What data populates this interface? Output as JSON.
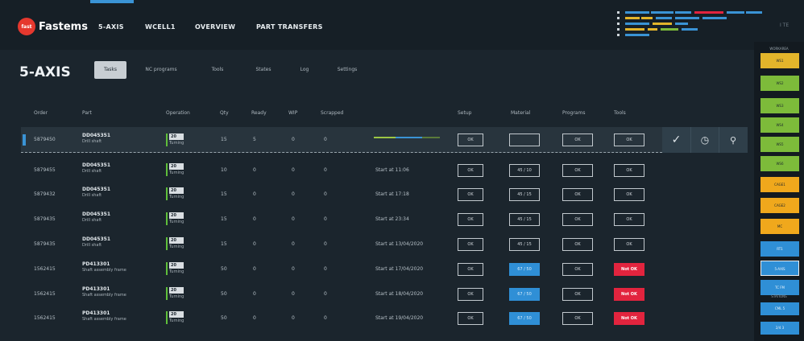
{
  "app": {
    "brand": "Fastems",
    "logo_mark": "fast",
    "top_right": "I TE"
  },
  "nav": [
    {
      "label": "5-AXIS",
      "active": true
    },
    {
      "label": "WCELL1",
      "active": false
    },
    {
      "label": "OVERVIEW",
      "active": false
    },
    {
      "label": "PART TRANSFERS",
      "active": false
    }
  ],
  "page": {
    "title": "5-AXIS"
  },
  "tabs": [
    {
      "label": "Tasks",
      "active": true
    },
    {
      "label": "NC programs",
      "active": false
    },
    {
      "label": "Tools",
      "active": false
    },
    {
      "label": "States",
      "active": false
    },
    {
      "label": "Log",
      "active": false
    },
    {
      "label": "Settings",
      "active": false
    }
  ],
  "columns": [
    "Order",
    "Part",
    "Operation",
    "Qty",
    "Ready",
    "WIP",
    "Scrapped",
    "Setup",
    "Material",
    "Programs",
    "Tools"
  ],
  "selected_row": {
    "order": "5879450",
    "part_code": "DD045351",
    "part_name": "Drill shaft",
    "op_num": "20",
    "op_name": "Turning",
    "qty": "15",
    "ready": "5",
    "wip": "0",
    "scrapped": "0",
    "progress_ready": 0.33,
    "progress_wip": 0.4,
    "setup": "OK",
    "material": "",
    "programs": "OK",
    "tools": "OK"
  },
  "rows": [
    {
      "order": "5879455",
      "part_code": "DD045351",
      "part_name": "Drill shaft",
      "op_num": "20",
      "op_name": "Turning",
      "qty": "10",
      "ready": "0",
      "wip": "0",
      "scrapped": "0",
      "status": "Start at 11:06",
      "setup": "OK",
      "material": "45 / 10",
      "material_style": "outline",
      "programs": "OK",
      "tools": "OK",
      "tools_style": "outline"
    },
    {
      "order": "5879432",
      "part_code": "DD045351",
      "part_name": "Drill shaft",
      "op_num": "20",
      "op_name": "Turning",
      "qty": "15",
      "ready": "0",
      "wip": "0",
      "scrapped": "0",
      "status": "Start at 17:18",
      "setup": "OK",
      "material": "45 / 15",
      "material_style": "outline",
      "programs": "OK",
      "tools": "OK",
      "tools_style": "outline"
    },
    {
      "order": "5879435",
      "part_code": "DD045351",
      "part_name": "Drill shaft",
      "op_num": "20",
      "op_name": "Turning",
      "qty": "15",
      "ready": "0",
      "wip": "0",
      "scrapped": "0",
      "status": "Start at 23:34",
      "setup": "OK",
      "material": "45 / 15",
      "material_style": "outline",
      "programs": "OK",
      "tools": "OK",
      "tools_style": "outline"
    },
    {
      "order": "5879435",
      "part_code": "DD045351",
      "part_name": "Drill shaft",
      "op_num": "20",
      "op_name": "Turning",
      "qty": "15",
      "ready": "0",
      "wip": "0",
      "scrapped": "0",
      "status": "Start at 13/04/2020",
      "setup": "OK",
      "material": "45 / 15",
      "material_style": "outline",
      "programs": "OK",
      "tools": "OK",
      "tools_style": "outline"
    },
    {
      "order": "1562415",
      "part_code": "PD413301",
      "part_name": "Shaft assembly frame",
      "op_num": "20",
      "op_name": "Turning",
      "qty": "50",
      "ready": "0",
      "wip": "0",
      "scrapped": "0",
      "status": "Start at 17/04/2020",
      "setup": "OK",
      "material": "67 / 50",
      "material_style": "blue",
      "programs": "OK",
      "tools": "Not OK",
      "tools_style": "red"
    },
    {
      "order": "1562415",
      "part_code": "PD413301",
      "part_name": "Shaft assembly frame",
      "op_num": "20",
      "op_name": "Turning",
      "qty": "50",
      "ready": "0",
      "wip": "0",
      "scrapped": "0",
      "status": "Start at 18/04/2020",
      "setup": "OK",
      "material": "67 / 50",
      "material_style": "blue",
      "programs": "OK",
      "tools": "Not OK",
      "tools_style": "red"
    },
    {
      "order": "1562415",
      "part_code": "PD413301",
      "part_name": "Shaft assembly frame",
      "op_num": "20",
      "op_name": "Turning",
      "qty": "50",
      "ready": "0",
      "wip": "0",
      "scrapped": "0",
      "status": "Start at 19/04/2020",
      "setup": "OK",
      "material": "67 / 50",
      "material_style": "blue",
      "programs": "OK",
      "tools": "Not OK",
      "tools_style": "red"
    }
  ],
  "actions": [
    {
      "icon": "check-icon",
      "label": "✓"
    },
    {
      "icon": "clock-icon",
      "label": "◷"
    },
    {
      "icon": "search-icon",
      "label": "⚲"
    }
  ],
  "side_panel": {
    "title_top": "WORKAREA",
    "title_bottom": "STATIONS",
    "chips": [
      {
        "label": "WS1",
        "color": "#e3b52b"
      },
      {
        "label": "WS2",
        "color": "#7dbb3a"
      },
      {
        "label": "WS3",
        "color": "#7dbb3a"
      },
      {
        "label": "WS4",
        "color": "#7dbb3a"
      },
      {
        "label": "WS5",
        "color": "#7dbb3a"
      },
      {
        "label": "WS6",
        "color": "#7dbb3a"
      },
      {
        "label": "CAGE1",
        "color": "#f0a81c"
      },
      {
        "label": "CAGE2",
        "color": "#f0a81c"
      },
      {
        "label": "MC",
        "color": "#f0a81c"
      },
      {
        "label": "RT1",
        "color": "#2f8fd6"
      },
      {
        "label": "5-AXIS",
        "color": "#2f8fd6"
      },
      {
        "label": "TC FM",
        "color": "#2f8fd6"
      }
    ],
    "bottom_chips": [
      {
        "label": "CML  5",
        "color": "#2f8fd6"
      },
      {
        "label": "2/4  3",
        "color": "#2f8fd6"
      }
    ]
  },
  "colors": {
    "accent": "#3a93d5",
    "ok_green": "#5fbf3a",
    "not_ok": "#e2243e"
  }
}
